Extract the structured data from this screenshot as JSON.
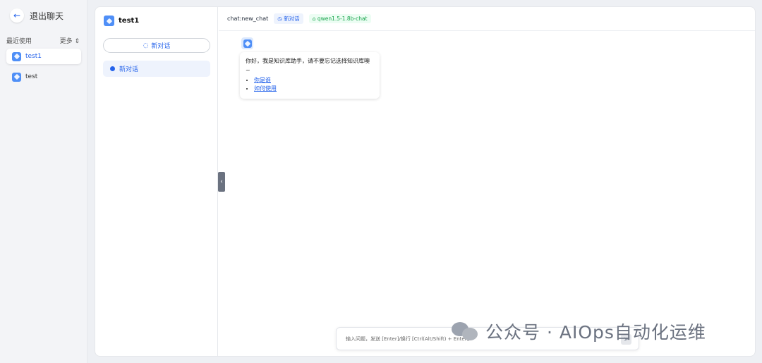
{
  "sidebar": {
    "exit_label": "退出聊天",
    "recent_label": "最近使用",
    "more_label": "更多",
    "apps": [
      {
        "name": "test1",
        "active": true
      },
      {
        "name": "test",
        "active": false
      }
    ]
  },
  "conversations": {
    "app_title": "test1",
    "new_chat_label": "新对话",
    "items": [
      {
        "label": "新对话"
      }
    ]
  },
  "chat": {
    "chat_id": "chat:new_chat",
    "tag_new": "新对话",
    "tag_model": "qwen1.5-1.8b-chat",
    "greeting": "你好，我是知识库助手，请不要忘记选择知识库噢~",
    "links": [
      "你是谁",
      "如何使用"
    ],
    "input_placeholder": "输入问题，发送 [Enter]/换行 [Ctrl(Alt/Shift) + Enter]"
  },
  "watermark": {
    "text": "公众号 · AIOps自动化运维"
  },
  "colors": {
    "accent": "#2563eb",
    "success": "#16a34a"
  }
}
